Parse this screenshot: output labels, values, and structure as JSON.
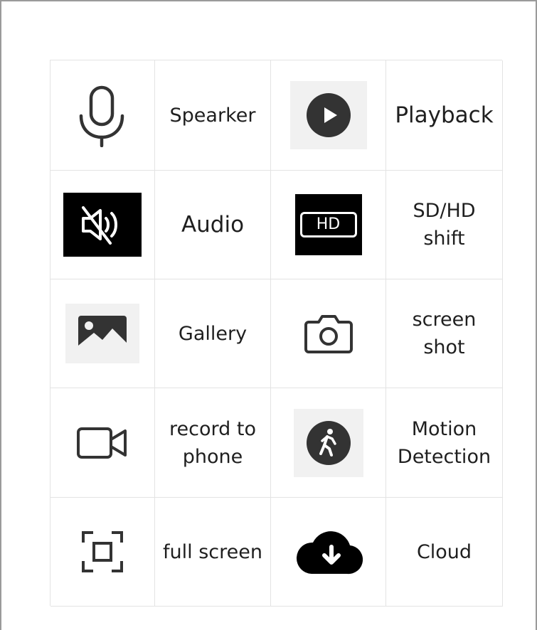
{
  "items": [
    {
      "icon": "microphone-icon",
      "label": "Spearker"
    },
    {
      "icon": "play-circle-icon",
      "label": "Playback"
    },
    {
      "icon": "speaker-muted-icon",
      "label": "Audio"
    },
    {
      "icon": "hd-icon",
      "icon_text": "HD",
      "label": "SD/HD\nshift"
    },
    {
      "icon": "image-icon",
      "label": "Gallery"
    },
    {
      "icon": "camera-icon",
      "label": "screen\nshot"
    },
    {
      "icon": "video-camera-icon",
      "label": "record to\nphone"
    },
    {
      "icon": "walking-person-icon",
      "label": "Motion\nDetection"
    },
    {
      "icon": "fullscreen-icon",
      "label": "full screen"
    },
    {
      "icon": "cloud-download-icon",
      "label": "Cloud"
    }
  ],
  "colors": {
    "icon_dark": "#333333",
    "icon_black": "#000000",
    "grid_line": "#e3e3e3",
    "icon_bg_gray": "#f1f1f1"
  }
}
